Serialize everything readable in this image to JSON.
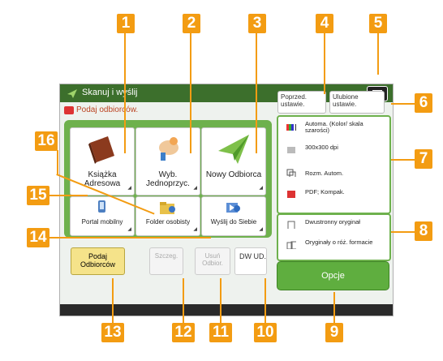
{
  "window": {
    "title": "Skanuj i wyślij",
    "prompt": "Podaj odbiorców."
  },
  "top_buttons": {
    "previous": "Poprzed. ustawie.",
    "favorites": "Ulubione ustawie."
  },
  "destination_tiles": [
    {
      "label": "Książka Adresowa"
    },
    {
      "label": "Wyb. Jednoprzyc."
    },
    {
      "label": "Nowy Odbiorca"
    },
    {
      "label": "Portal mobilny"
    },
    {
      "label": "Folder osobisty"
    },
    {
      "label": "Wyślij do Siebie"
    }
  ],
  "settings": [
    {
      "label": "Automa. (Kolor/ skala szarości)",
      "icon": "color-mode-icon"
    },
    {
      "label": "300x300 dpi",
      "icon": "resolution-icon"
    },
    {
      "label": "Rozm. Autom.",
      "icon": "size-icon"
    },
    {
      "label": "PDF; Kompak.",
      "icon": "pdf-icon"
    }
  ],
  "original_settings": [
    {
      "label": "Dwustronny oryginał",
      "icon": "duplex-icon"
    },
    {
      "label": "Oryginały o róż. formacie",
      "icon": "mixed-size-icon"
    }
  ],
  "bottom_buttons": {
    "specify": "Podaj Odbiorców",
    "details": "Szczeg.",
    "delete": "Usuń Odbior.",
    "dw": "DW UD."
  },
  "options_button": "Opcje",
  "callouts": [
    "1",
    "2",
    "3",
    "4",
    "5",
    "6",
    "7",
    "8",
    "9",
    "10",
    "11",
    "12",
    "13",
    "14",
    "15",
    "16"
  ],
  "colors": {
    "callout": "#f39c12",
    "title_bar": "#3c6f2c",
    "panel": "#6eb14d",
    "options": "#5fae3f"
  }
}
